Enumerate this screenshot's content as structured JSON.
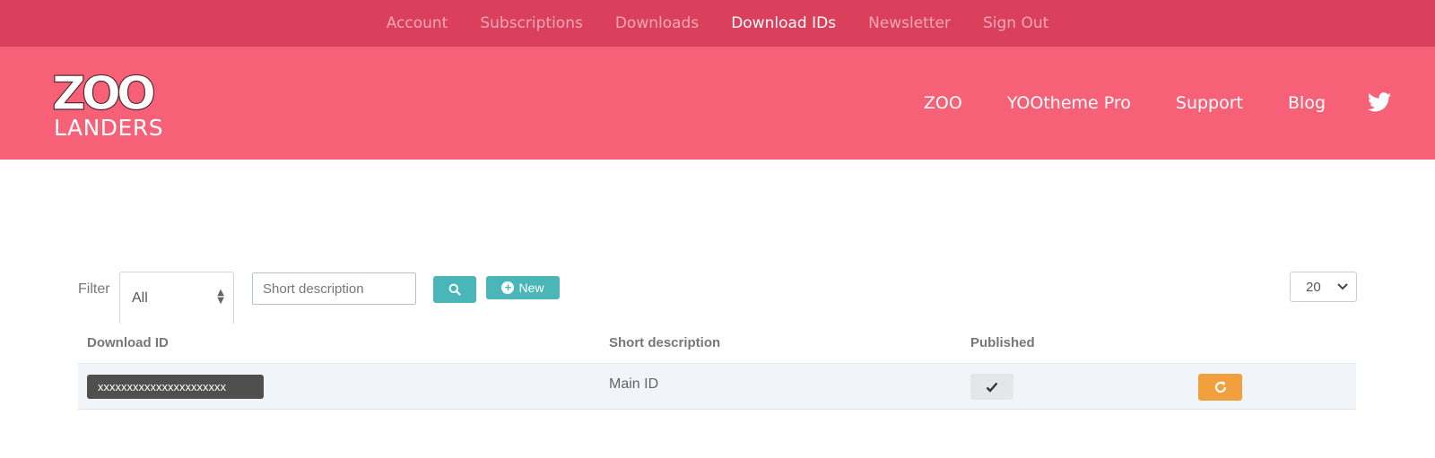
{
  "topnav": {
    "items": [
      {
        "label": "Account"
      },
      {
        "label": "Subscriptions"
      },
      {
        "label": "Downloads"
      },
      {
        "label": "Download IDs",
        "active": true
      },
      {
        "label": "Newsletter"
      },
      {
        "label": "Sign Out"
      }
    ]
  },
  "header": {
    "logo_top": "ZOO",
    "logo_bottom": "LANDERS",
    "nav": [
      {
        "label": "ZOO"
      },
      {
        "label": "YOOtheme Pro"
      },
      {
        "label": "Support"
      },
      {
        "label": "Blog"
      }
    ],
    "social_icon": "twitter-icon"
  },
  "toolbar": {
    "filter_label": "Filter",
    "filter_value": "All",
    "search_placeholder": "Short description",
    "new_label": "New",
    "limit_value": "20"
  },
  "table": {
    "columns": [
      "Download ID",
      "Short description",
      "Published"
    ],
    "rows": [
      {
        "download_id": "xxxxxxxxxxxxxxxxxxxxxx",
        "short_description": "Main ID",
        "published": true
      }
    ]
  },
  "colors": {
    "topbar": "#da3f5b",
    "header": "#f76177",
    "teal_button": "#4ab6b8",
    "orange_button": "#f0a03c",
    "id_pill": "#4f4f4f"
  }
}
